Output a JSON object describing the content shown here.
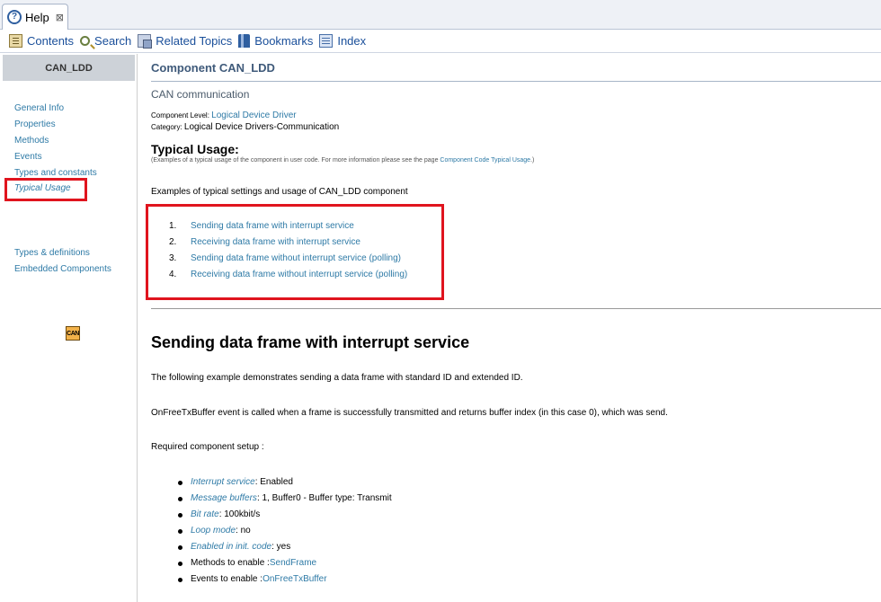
{
  "tab": {
    "title": "Help",
    "close": "⊠"
  },
  "toolbar": {
    "contents": "Contents",
    "search": "Search",
    "related": "Related Topics",
    "bookmarks": "Bookmarks",
    "index": "Index"
  },
  "nav": {
    "header": "CAN_LDD",
    "items": [
      "General Info",
      "Properties",
      "Methods",
      "Events",
      "Types and constants",
      "Typical Usage"
    ],
    "items2": [
      "Types & definitions",
      "Embedded Components"
    ],
    "logo_text": "CAN"
  },
  "main": {
    "component_title": "Component CAN_LDD",
    "subtitle": "CAN communication",
    "level_label": "Component Level: ",
    "level_value": "Logical Device Driver",
    "category_label": "Category: ",
    "category_value": "Logical Device Drivers-Communication",
    "typical_heading": "Typical Usage:",
    "typical_note_pre": "(Examples of a typical usage of the component in user code. For more information please see the page ",
    "typical_note_link": "Component Code Typical Usage",
    "typical_note_post": ".)",
    "examples_intro": "Examples of typical settings and usage of CAN_LDD component",
    "examples": [
      {
        "num": "1.",
        "label": "Sending data frame with interrupt service"
      },
      {
        "num": "2.",
        "label": "Receiving data frame with interrupt service"
      },
      {
        "num": "3.",
        "label": "Sending data frame without interrupt service (polling)"
      },
      {
        "num": "4.",
        "label": "Receiving data frame without interrupt service (polling)"
      }
    ],
    "section_heading": "Sending data frame with interrupt service",
    "para1": "The following example demonstrates sending a data frame with standard ID and extended ID.",
    "para2": "OnFreeTxBuffer event is called when a frame is successfully transmitted and returns buffer index (in this case 0), which was send.",
    "para3": "Required component setup :",
    "setup": [
      {
        "label": "Interrupt service",
        "value": " : Enabled"
      },
      {
        "label": "Message buffers",
        "value": " : 1, Buffer0 - Buffer type: Transmit"
      },
      {
        "label": "Bit rate",
        "value": " : 100kbit/s"
      },
      {
        "label": "Loop mode",
        "value": " : no"
      },
      {
        "label": "Enabled in init. code",
        "value": " : yes"
      }
    ],
    "methods_label": "Methods to enable : ",
    "methods_value": "SendFrame",
    "events_label": "Events to enable : ",
    "events_value": "OnFreeTxBuffer"
  }
}
